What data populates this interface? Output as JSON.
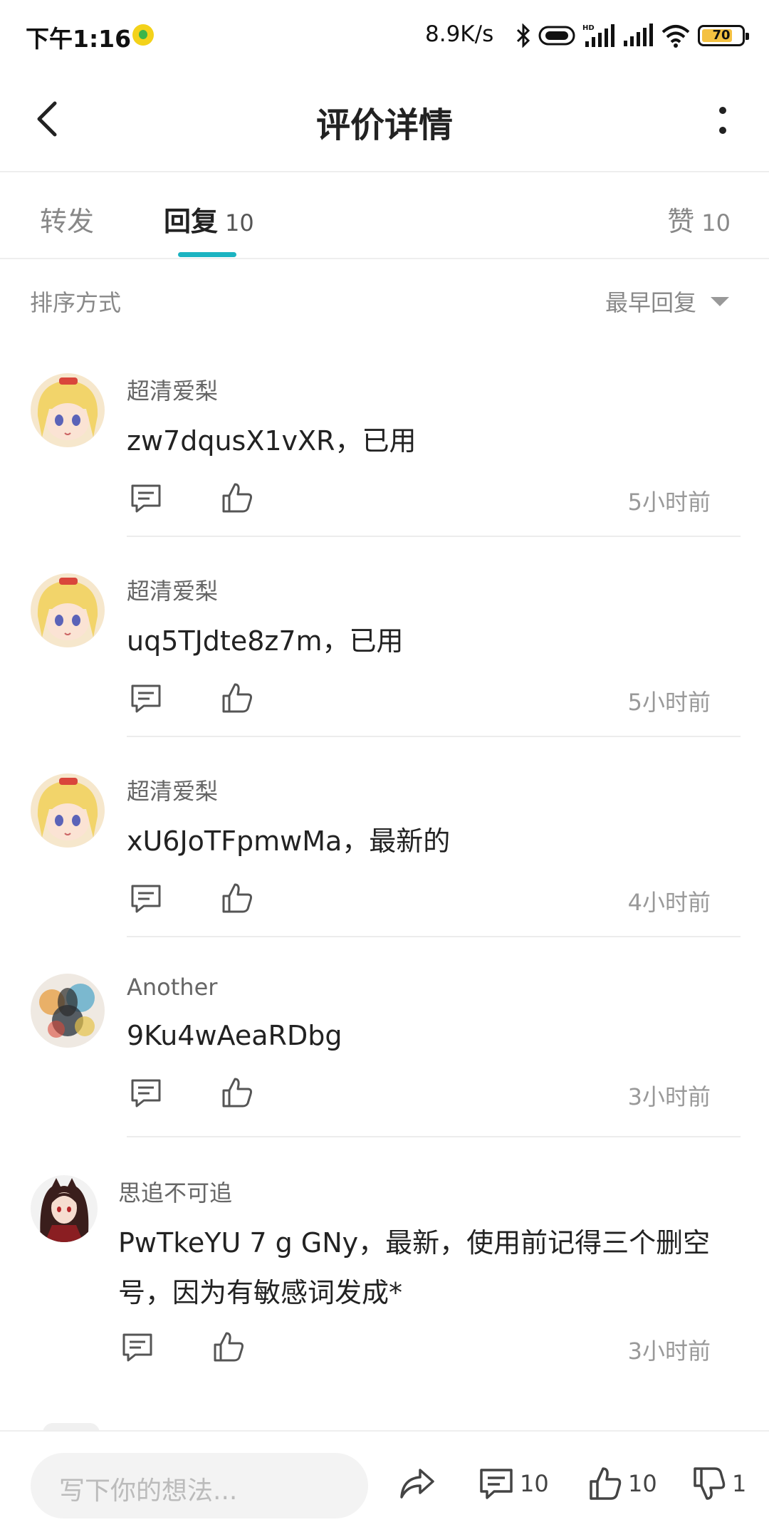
{
  "status_bar": {
    "time": "下午1:16",
    "net_speed": "8.9K/s",
    "battery": "70"
  },
  "header": {
    "title": "评价详情",
    "back_icon": "chevron-left-icon",
    "more_icon": "more-vertical-icon"
  },
  "tabs": [
    {
      "label": "转发",
      "count": ""
    },
    {
      "label": "回复",
      "count": "10"
    },
    {
      "label": "赞",
      "count": "10"
    }
  ],
  "accent_color": "#1bb3c1",
  "sort": {
    "label": "排序方式",
    "value": "最早回复"
  },
  "comments": [
    {
      "user": "超清爱梨",
      "text": "zw7dqusX1vXR，已用",
      "time": "5小时前",
      "avatar": "anime-blonde"
    },
    {
      "user": "超清爱梨",
      "text": "uq5TJdte8z7m，已用",
      "time": "5小时前",
      "avatar": "anime-blonde"
    },
    {
      "user": "超清爱梨",
      "text": "xU6JoTFpmwMa，最新的",
      "time": "4小时前",
      "avatar": "anime-blonde"
    },
    {
      "user": "Another",
      "text": "9Ku4wAeaRDbg",
      "time": "3小时前",
      "avatar": "watercolor-dog"
    },
    {
      "user": "思追不可追",
      "text": "PwTkeYU 7 g GNy，最新，使用前记得三个删空号，因为有敏感词发成*",
      "time": "3小时前",
      "avatar": "anime-dark"
    }
  ],
  "bottom_bar": {
    "placeholder": "写下你的想法...",
    "comment_count": "10",
    "like_count": "10",
    "dislike_count": "1"
  }
}
